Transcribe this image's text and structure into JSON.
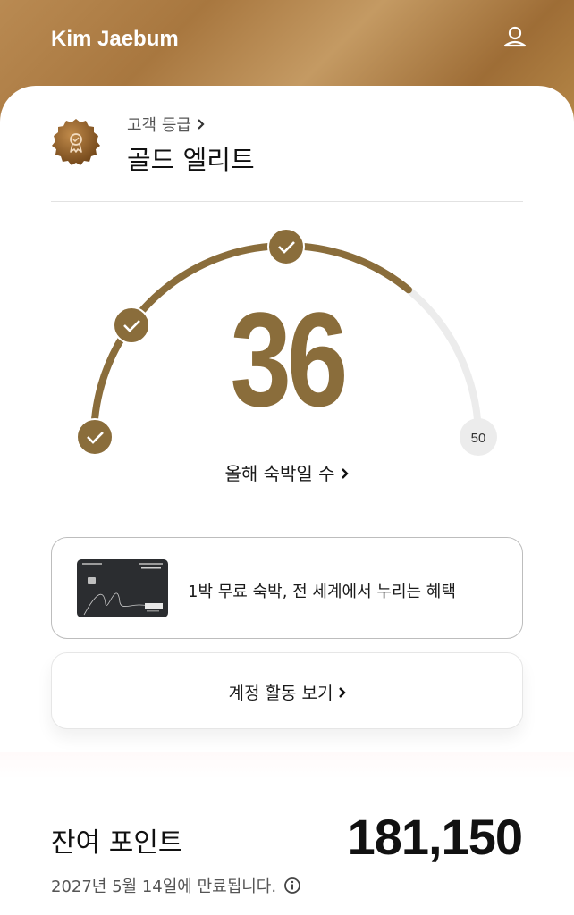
{
  "header": {
    "user_name": "Kim Jaebum",
    "profile_icon": "user-profile-icon"
  },
  "tier": {
    "caption": "고객 등급",
    "caption_chevron": "›",
    "name": "골드 엘리트",
    "badge_icon": "award-medal-icon"
  },
  "nights": {
    "count": "36",
    "max_label": "50",
    "label": "올해 숙박일 수",
    "progress_fraction": 0.72,
    "milestones_achieved": 3,
    "check_icon": "checkmark-icon"
  },
  "offer": {
    "text": "1박 무료 숙박, 전 세계에서 누리는 혜택",
    "card_image": "marriott-bonvoy-visa-card"
  },
  "activity": {
    "label": "계정 활동 보기"
  },
  "points": {
    "label": "잔여 포인트",
    "value": "181,150",
    "expiry": "2027년 5월 14일에 만료됩니다.",
    "info_icon": "info-icon"
  },
  "colors": {
    "gold": "#8a6d3b",
    "track": "#ececec",
    "banner": "#b58747"
  }
}
